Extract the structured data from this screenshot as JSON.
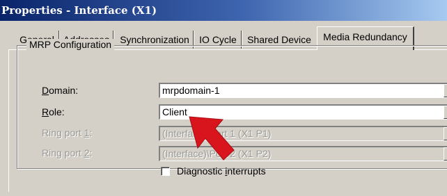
{
  "window": {
    "title": "Properties - Interface (X1)"
  },
  "tabs": [
    {
      "label": "General",
      "active": false
    },
    {
      "label": "Addresses",
      "active": false
    },
    {
      "label": "Synchronization",
      "active": false
    },
    {
      "label": "IO Cycle",
      "active": false
    },
    {
      "label": "Shared Device",
      "active": false
    },
    {
      "label": "Media Redundancy",
      "active": true
    }
  ],
  "mrp": {
    "group_title": "MRP Configuration",
    "domain": {
      "label_u": "D",
      "label_rest": "omain:",
      "value": "mrpdomain-1"
    },
    "role": {
      "label_u": "R",
      "label_rest": "ole:",
      "value": "Client"
    },
    "ring_port_1": {
      "label_pre": "Ring port ",
      "label_u": "1",
      "label_post": ":",
      "value": "(Interface)\\Port 1 (X1 P1)"
    },
    "ring_port_2": {
      "label_pre": "Ring port ",
      "label_u": "2",
      "label_post": ":",
      "value": "(Interface)\\Port 2 (X1 P2)"
    },
    "diagnostic": {
      "label_pre": "Diagnostic ",
      "label_u": "i",
      "label_post": "nterrupts",
      "checked": false
    }
  },
  "colors": {
    "dialog_bg": "#d4d0c8",
    "title_gradient_start": "#0a246a",
    "title_gradient_end": "#a6caf0",
    "pointer_arrow": "#d8151d"
  },
  "icons": {
    "dropdown": "chevron-down-icon",
    "pointer": "red-arrow-annotation"
  }
}
